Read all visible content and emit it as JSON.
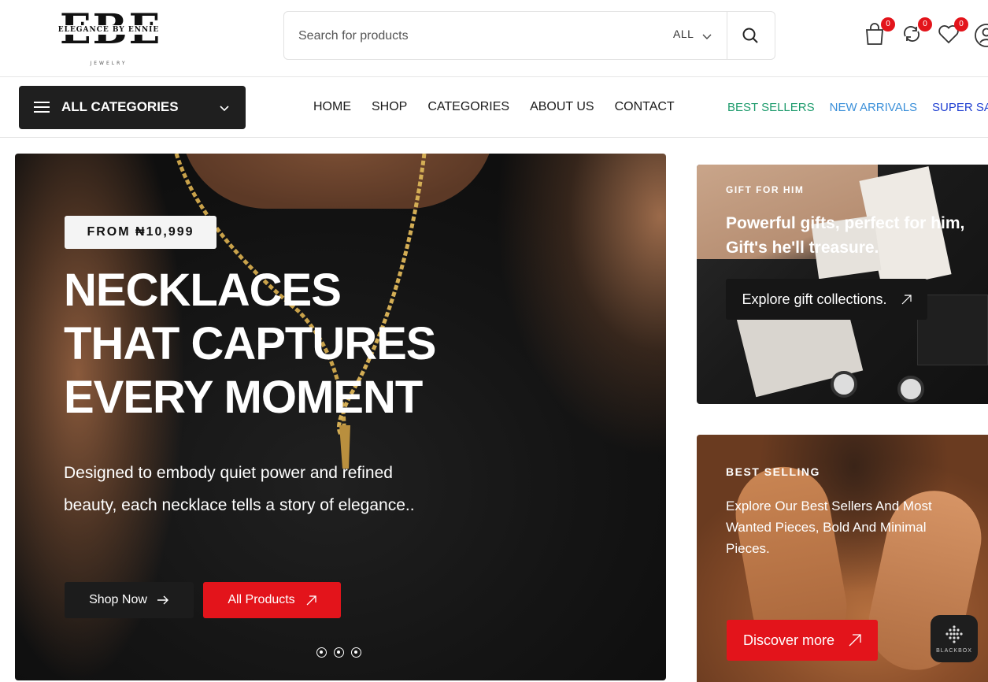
{
  "brand": {
    "monogram": "EBE",
    "name": "ELEGANCE BY ENNIE",
    "tagline": "JEWELRY"
  },
  "search": {
    "placeholder": "Search for products",
    "category": "ALL"
  },
  "header_icons": {
    "cart_count": "0",
    "compare_count": "0",
    "wishlist_count": "0"
  },
  "nav": {
    "all_categories": "ALL CATEGORIES",
    "menu": [
      "HOME",
      "SHOP",
      "CATEGORIES",
      "ABOUT US",
      "CONTACT"
    ],
    "promo": [
      {
        "label": "BEST SELLERS",
        "color": "#1d9b6c"
      },
      {
        "label": "NEW ARRIVALS",
        "color": "#3a8fd9"
      },
      {
        "label": "SUPER SALE",
        "color": "#1f3fd1"
      }
    ]
  },
  "hero": {
    "price_tag": "FROM ₦10,999",
    "headline": [
      "NECKLACES",
      "THAT CAPTURES",
      "EVERY MOMENT"
    ],
    "description": "Designed to embody quiet power and refined beauty, each necklace tells a story of elegance..",
    "shop_now": "Shop Now",
    "all_products": "All Products",
    "slides": 3
  },
  "gift_banner": {
    "kicker": "GIFT FOR HIM",
    "title": "Powerful gifts, perfect for him, Gift's he'll treasure.",
    "cta": "Explore gift collections."
  },
  "best_banner": {
    "kicker": "BEST SELLING",
    "text": "Explore Our Best Sellers And Most Wanted Pieces, Bold And Minimal Pieces.",
    "cta": "Discover more"
  },
  "widget": {
    "label": "BLACKBOX"
  },
  "colors": {
    "accent_red": "#e3141b",
    "dark": "#1f1f1f",
    "best_sellers": "#1d9b6c",
    "new_arrivals": "#3a8fd9",
    "super_sale": "#1f3fd1"
  }
}
